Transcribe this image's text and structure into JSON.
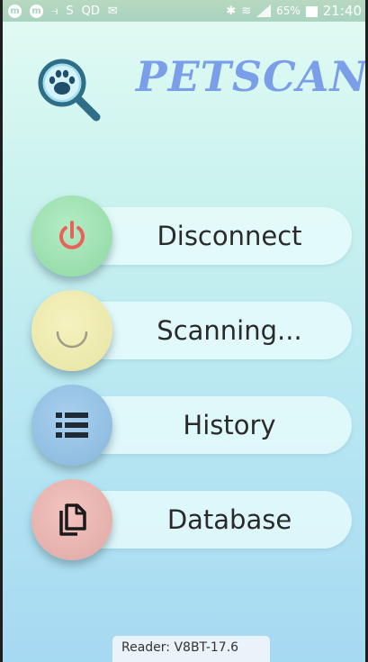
{
  "status_bar": {
    "left_icons": [
      {
        "icon": "m-app-icon",
        "glyph": "m"
      },
      {
        "icon": "m-app-icon",
        "glyph": "m"
      },
      {
        "icon": "hotspot-icon",
        "glyph": "⥽"
      },
      {
        "icon": "sync-icon",
        "glyph": "S"
      },
      {
        "icon": "voicemail-icon",
        "glyph": "QD"
      },
      {
        "icon": "mail-icon",
        "glyph": "✉"
      }
    ],
    "bluetooth": "✱",
    "wifi": "≋",
    "battery_percent": "65%",
    "time": "21:40"
  },
  "app": {
    "title": "PETSCAN",
    "accent_color": "#7a9fe8"
  },
  "menu": [
    {
      "label": "Disconnect",
      "icon": "power-icon",
      "color": "#8ed8a2"
    },
    {
      "label": "Scanning...",
      "icon": "loading-spinner-icon",
      "color": "#e6e4a2"
    },
    {
      "label": "History",
      "icon": "list-icon",
      "color": "#86b7dc"
    },
    {
      "label": "Database",
      "icon": "documents-icon",
      "color": "#e0a8a4"
    }
  ],
  "footer": {
    "reader": "Reader: V8BT-17.6"
  }
}
